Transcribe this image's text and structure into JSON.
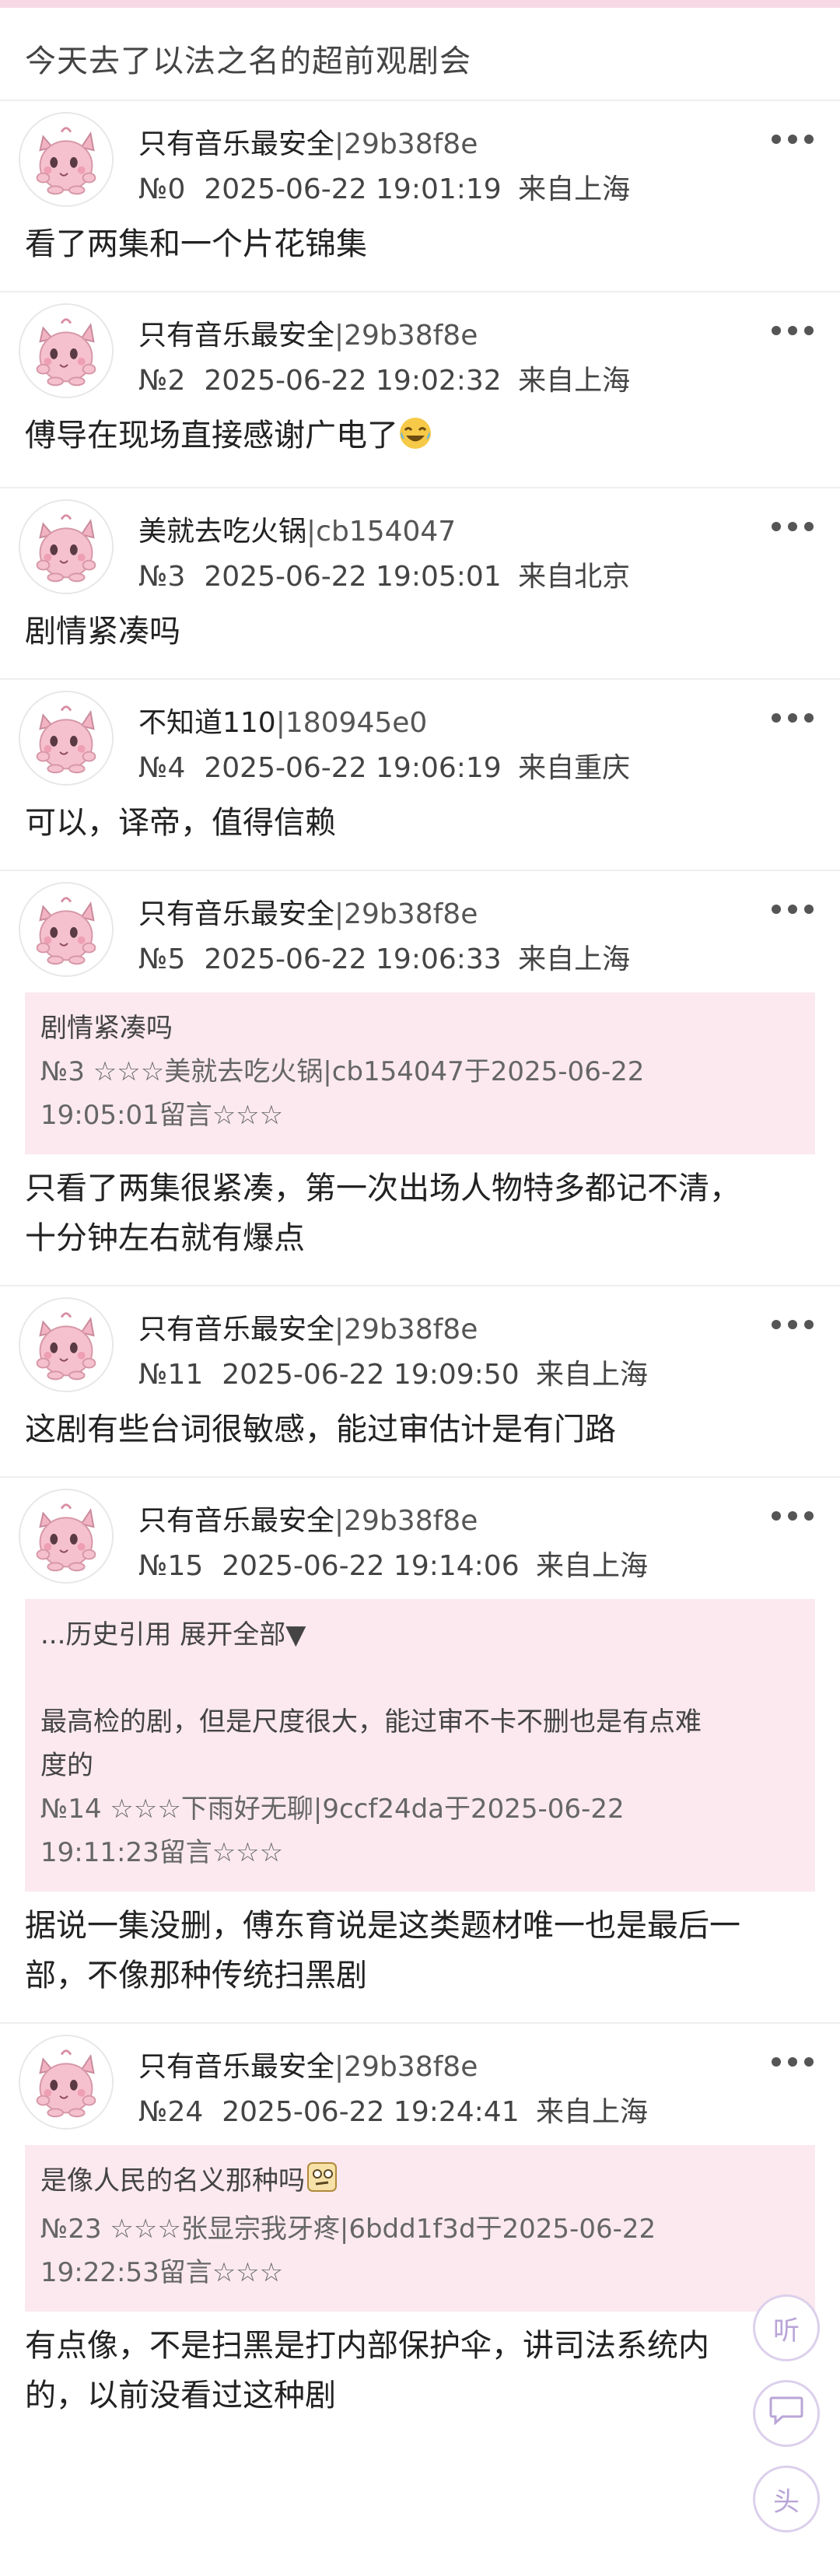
{
  "thread": {
    "title": "今天去了以法之名的超前观剧会"
  },
  "posts": [
    {
      "username": "只有音乐最安全",
      "uid": "|29b38f8e",
      "floor": "№0",
      "time": "2025-06-22 19:01:19",
      "location": "来自上海",
      "body": "看了两集和一个片花锦集"
    },
    {
      "username": "只有音乐最安全",
      "uid": "|29b38f8e",
      "floor": "№2",
      "time": "2025-06-22 19:02:32",
      "location": "来自上海",
      "body": "傅导在现场直接感谢广电了",
      "emoji": "laughing-tears-emoji"
    },
    {
      "username": "美就去吃火锅",
      "uid": "|cb154047",
      "floor": "№3",
      "time": "2025-06-22 19:05:01",
      "location": "来自北京",
      "body": "剧情紧凑吗"
    },
    {
      "username": "不知道110",
      "uid": "|180945e0",
      "floor": "№4",
      "time": "2025-06-22 19:06:19",
      "location": "来自重庆",
      "body": "可以，译帝，值得信赖"
    },
    {
      "username": "只有音乐最安全",
      "uid": "|29b38f8e",
      "floor": "№5",
      "time": "2025-06-22 19:06:33",
      "location": "来自上海",
      "quote": {
        "text": "剧情紧凑吗",
        "line1": "№3 ☆☆☆美就去吃火锅|cb154047于2025-06-22",
        "line2": "19:05:01留言☆☆☆"
      },
      "body_lines": [
        "只看了两集很紧凑，第一次出场人物特多都记不清，",
        "十分钟左右就有爆点"
      ]
    },
    {
      "username": "只有音乐最安全",
      "uid": "|29b38f8e",
      "floor": "№11",
      "time": "2025-06-22 19:09:50",
      "location": "来自上海",
      "body": "这剧有些台词很敏感，能过审估计是有门路"
    },
    {
      "username": "只有音乐最安全",
      "uid": "|29b38f8e",
      "floor": "№15",
      "time": "2025-06-22 19:14:06",
      "location": "来自上海",
      "quote": {
        "expand": "...历史引用 展开全部▼",
        "text_lines": [
          "最高检的剧，但是尺度很大，能过审不卡不删也是有点难",
          "度的"
        ],
        "line1": "№14 ☆☆☆下雨好无聊|9ccf24da于2025-06-22",
        "line2": "19:11:23留言☆☆☆"
      },
      "body_lines": [
        "据说一集没删，傅东育说是这类题材唯一也是最后一",
        "部，不像那种传统扫黑剧"
      ]
    },
    {
      "username": "只有音乐最安全",
      "uid": "|29b38f8e",
      "floor": "№24",
      "time": "2025-06-22 19:24:41",
      "location": "来自上海",
      "quote": {
        "text": "是像人民的名义那种吗",
        "emoji": "thinking-emoji",
        "line1": "№23 ☆☆☆张显宗我牙疼|6bdd1f3d于2025-06-22",
        "line2": "19:22:53留言☆☆☆"
      },
      "body_lines": [
        "有点像，不是扫黑是打内部保护伞，讲司法系统内",
        "的，以前没看过这种剧"
      ]
    }
  ],
  "fab": {
    "listen_label": "听",
    "comment_icon": "comment-bubble-icon",
    "top_label": "头"
  },
  "colors": {
    "quote_bg": "#fbe9ef",
    "topbar": "#f7d9e6",
    "fab_border": "#dcd0ec"
  }
}
